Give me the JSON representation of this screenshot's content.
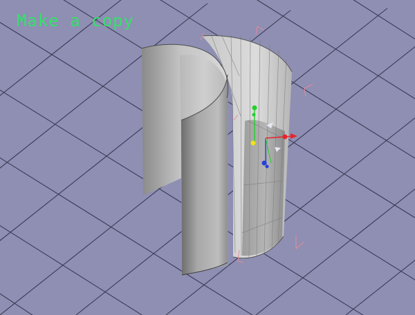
{
  "viewport": {
    "caption": "Make a copy",
    "background_color": "#8e8fb3",
    "grid_color": "#3a3b55",
    "caption_color": "#36e06a",
    "object_color": "#b9b9b9",
    "selection_color": "#e88a9a"
  },
  "gizmo": {
    "icon_names": [
      "move-y-axis-icon",
      "move-x-axis-icon",
      "move-z-axis-icon",
      "rotate-handle-icon",
      "pivot-icon"
    ],
    "axis_colors": {
      "x": "#e8232a",
      "y": "#22d02a",
      "z": "#2440e0",
      "pivot": "#f0e020"
    }
  }
}
